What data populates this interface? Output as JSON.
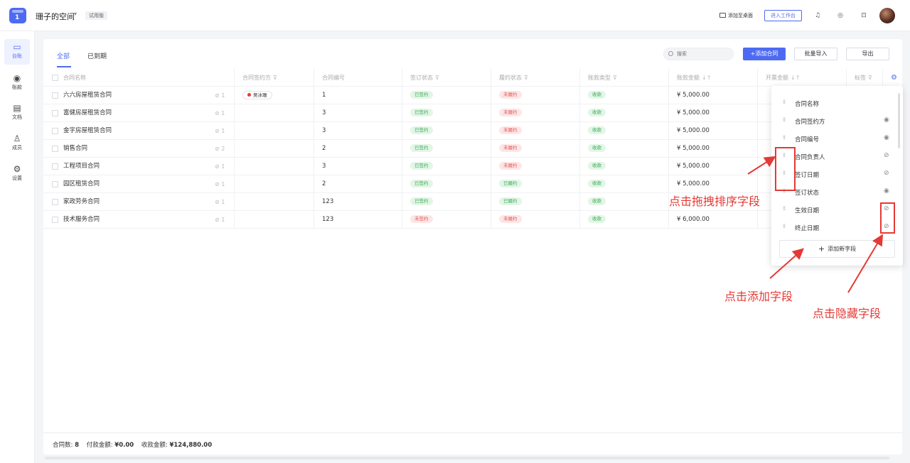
{
  "header": {
    "logo_glyph": "1",
    "space_name": "珊子的空间",
    "trial_badge": "试用版",
    "add_to_desktop": "添加至桌面",
    "enter_workbench": "进入工作台"
  },
  "sidenav": {
    "items": [
      {
        "icon": "monitor-icon",
        "label": "台账",
        "active": true
      },
      {
        "icon": "target-icon",
        "label": "账款"
      },
      {
        "icon": "document-icon",
        "label": "文档"
      },
      {
        "icon": "user-icon",
        "label": "成员"
      },
      {
        "icon": "settings-icon",
        "label": "设置"
      }
    ]
  },
  "tabs": {
    "all": "全部",
    "expired": "已到期"
  },
  "toolbar": {
    "search_placeholder": "搜索",
    "add_contract": "+添加合同",
    "batch_import": "批量导入",
    "export": "导出"
  },
  "table": {
    "headers": {
      "name": "合同名称",
      "party": "合同签约方",
      "number": "合同编号",
      "sign_status": "签订状态",
      "perform_status": "履约状态",
      "payment_type": "账款类型",
      "amount": "账款金额",
      "invoice_amount": "开票金额",
      "tag": "标签"
    },
    "rows": [
      {
        "name": "六六房屋租赁合同",
        "attachments": "1",
        "party": "吴冰珊",
        "number": "1",
        "sign_status": "已签约",
        "perform_status": "未履约",
        "payment_type": "收款",
        "amount": "¥ 5,000.00"
      },
      {
        "name": "富健房屋租赁合同",
        "attachments": "1",
        "party": "",
        "number": "3",
        "sign_status": "已签约",
        "perform_status": "未履约",
        "payment_type": "收款",
        "amount": "¥ 5,000.00"
      },
      {
        "name": "金字房屋租赁合同",
        "attachments": "1",
        "party": "",
        "number": "3",
        "sign_status": "已签约",
        "perform_status": "未履约",
        "payment_type": "收款",
        "amount": "¥ 5,000.00"
      },
      {
        "name": "销售合同",
        "attachments": "2",
        "party": "",
        "number": "2",
        "sign_status": "已签约",
        "perform_status": "未履约",
        "payment_type": "收款",
        "amount": "¥ 5,000.00"
      },
      {
        "name": "工程项目合同",
        "attachments": "1",
        "party": "",
        "number": "3",
        "sign_status": "已签约",
        "perform_status": "未履约",
        "payment_type": "收款",
        "amount": "¥ 5,000.00"
      },
      {
        "name": "园区租赁合同",
        "attachments": "1",
        "party": "",
        "number": "2",
        "sign_status": "已签约",
        "perform_status": "已履约",
        "payment_type": "收款",
        "amount": "¥ 5,000.00"
      },
      {
        "name": "家政劳务合同",
        "attachments": "1",
        "party": "",
        "number": "123",
        "sign_status": "已签约",
        "perform_status": "已履约",
        "payment_type": "收款",
        "amount": ""
      },
      {
        "name": "技术服务合同",
        "attachments": "1",
        "party": "",
        "number": "123",
        "sign_status": "未签约",
        "perform_status": "未履约",
        "payment_type": "收款",
        "amount": "¥ 6,000.00"
      }
    ]
  },
  "summary": {
    "count_label": "合同数:",
    "count": "8",
    "paid_label": "付款金额:",
    "paid": "¥0.00",
    "received_label": "收款金额:",
    "received": "¥124,880.00"
  },
  "field_panel": {
    "fields": [
      {
        "label": "合同名称",
        "eye": ""
      },
      {
        "label": "合同签约方",
        "eye": "visible"
      },
      {
        "label": "合同编号",
        "eye": "visible"
      },
      {
        "label": "合同负责人",
        "eye": "hidden"
      },
      {
        "label": "签订日期",
        "eye": "hidden"
      },
      {
        "label": "签订状态",
        "eye": "visible"
      },
      {
        "label": "生效日期",
        "eye": "hidden"
      },
      {
        "label": "终止日期",
        "eye": "hidden"
      }
    ],
    "add_field": "添加新字段"
  },
  "annotations": {
    "drag_sort": "点击拖拽排序字段",
    "add_field": "点击添加字段",
    "hide_field": "点击隐藏字段"
  },
  "colors": {
    "accent": "#4d6bf2",
    "annotation": "#e53935",
    "success": "#3fa95b",
    "danger": "#e25959"
  }
}
